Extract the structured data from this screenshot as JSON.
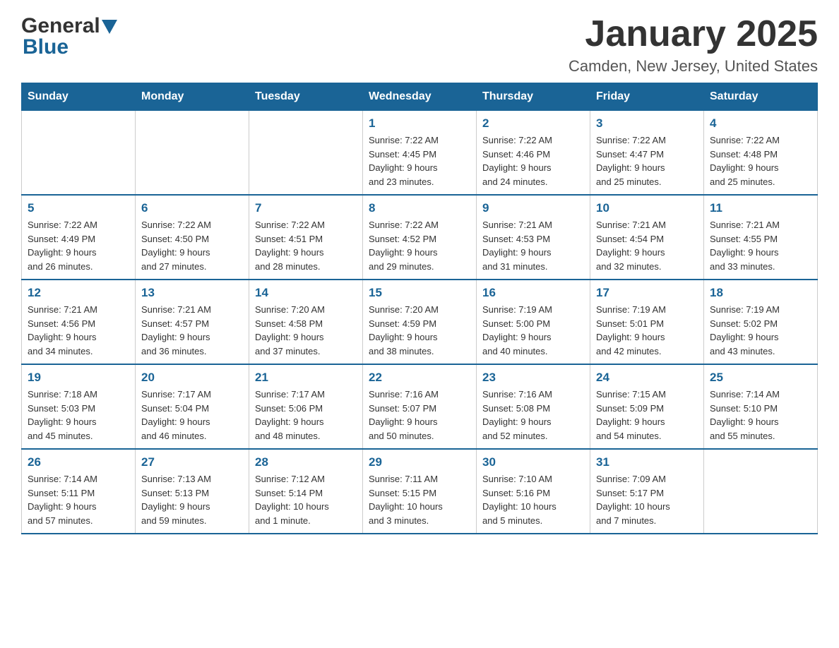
{
  "logo": {
    "general": "General",
    "blue": "Blue",
    "triangle_color": "#1a6496"
  },
  "header": {
    "title": "January 2025",
    "subtitle": "Camden, New Jersey, United States"
  },
  "weekdays": [
    "Sunday",
    "Monday",
    "Tuesday",
    "Wednesday",
    "Thursday",
    "Friday",
    "Saturday"
  ],
  "weeks": [
    [
      {
        "day": "",
        "info": ""
      },
      {
        "day": "",
        "info": ""
      },
      {
        "day": "",
        "info": ""
      },
      {
        "day": "1",
        "info": "Sunrise: 7:22 AM\nSunset: 4:45 PM\nDaylight: 9 hours\nand 23 minutes."
      },
      {
        "day": "2",
        "info": "Sunrise: 7:22 AM\nSunset: 4:46 PM\nDaylight: 9 hours\nand 24 minutes."
      },
      {
        "day": "3",
        "info": "Sunrise: 7:22 AM\nSunset: 4:47 PM\nDaylight: 9 hours\nand 25 minutes."
      },
      {
        "day": "4",
        "info": "Sunrise: 7:22 AM\nSunset: 4:48 PM\nDaylight: 9 hours\nand 25 minutes."
      }
    ],
    [
      {
        "day": "5",
        "info": "Sunrise: 7:22 AM\nSunset: 4:49 PM\nDaylight: 9 hours\nand 26 minutes."
      },
      {
        "day": "6",
        "info": "Sunrise: 7:22 AM\nSunset: 4:50 PM\nDaylight: 9 hours\nand 27 minutes."
      },
      {
        "day": "7",
        "info": "Sunrise: 7:22 AM\nSunset: 4:51 PM\nDaylight: 9 hours\nand 28 minutes."
      },
      {
        "day": "8",
        "info": "Sunrise: 7:22 AM\nSunset: 4:52 PM\nDaylight: 9 hours\nand 29 minutes."
      },
      {
        "day": "9",
        "info": "Sunrise: 7:21 AM\nSunset: 4:53 PM\nDaylight: 9 hours\nand 31 minutes."
      },
      {
        "day": "10",
        "info": "Sunrise: 7:21 AM\nSunset: 4:54 PM\nDaylight: 9 hours\nand 32 minutes."
      },
      {
        "day": "11",
        "info": "Sunrise: 7:21 AM\nSunset: 4:55 PM\nDaylight: 9 hours\nand 33 minutes."
      }
    ],
    [
      {
        "day": "12",
        "info": "Sunrise: 7:21 AM\nSunset: 4:56 PM\nDaylight: 9 hours\nand 34 minutes."
      },
      {
        "day": "13",
        "info": "Sunrise: 7:21 AM\nSunset: 4:57 PM\nDaylight: 9 hours\nand 36 minutes."
      },
      {
        "day": "14",
        "info": "Sunrise: 7:20 AM\nSunset: 4:58 PM\nDaylight: 9 hours\nand 37 minutes."
      },
      {
        "day": "15",
        "info": "Sunrise: 7:20 AM\nSunset: 4:59 PM\nDaylight: 9 hours\nand 38 minutes."
      },
      {
        "day": "16",
        "info": "Sunrise: 7:19 AM\nSunset: 5:00 PM\nDaylight: 9 hours\nand 40 minutes."
      },
      {
        "day": "17",
        "info": "Sunrise: 7:19 AM\nSunset: 5:01 PM\nDaylight: 9 hours\nand 42 minutes."
      },
      {
        "day": "18",
        "info": "Sunrise: 7:19 AM\nSunset: 5:02 PM\nDaylight: 9 hours\nand 43 minutes."
      }
    ],
    [
      {
        "day": "19",
        "info": "Sunrise: 7:18 AM\nSunset: 5:03 PM\nDaylight: 9 hours\nand 45 minutes."
      },
      {
        "day": "20",
        "info": "Sunrise: 7:17 AM\nSunset: 5:04 PM\nDaylight: 9 hours\nand 46 minutes."
      },
      {
        "day": "21",
        "info": "Sunrise: 7:17 AM\nSunset: 5:06 PM\nDaylight: 9 hours\nand 48 minutes."
      },
      {
        "day": "22",
        "info": "Sunrise: 7:16 AM\nSunset: 5:07 PM\nDaylight: 9 hours\nand 50 minutes."
      },
      {
        "day": "23",
        "info": "Sunrise: 7:16 AM\nSunset: 5:08 PM\nDaylight: 9 hours\nand 52 minutes."
      },
      {
        "day": "24",
        "info": "Sunrise: 7:15 AM\nSunset: 5:09 PM\nDaylight: 9 hours\nand 54 minutes."
      },
      {
        "day": "25",
        "info": "Sunrise: 7:14 AM\nSunset: 5:10 PM\nDaylight: 9 hours\nand 55 minutes."
      }
    ],
    [
      {
        "day": "26",
        "info": "Sunrise: 7:14 AM\nSunset: 5:11 PM\nDaylight: 9 hours\nand 57 minutes."
      },
      {
        "day": "27",
        "info": "Sunrise: 7:13 AM\nSunset: 5:13 PM\nDaylight: 9 hours\nand 59 minutes."
      },
      {
        "day": "28",
        "info": "Sunrise: 7:12 AM\nSunset: 5:14 PM\nDaylight: 10 hours\nand 1 minute."
      },
      {
        "day": "29",
        "info": "Sunrise: 7:11 AM\nSunset: 5:15 PM\nDaylight: 10 hours\nand 3 minutes."
      },
      {
        "day": "30",
        "info": "Sunrise: 7:10 AM\nSunset: 5:16 PM\nDaylight: 10 hours\nand 5 minutes."
      },
      {
        "day": "31",
        "info": "Sunrise: 7:09 AM\nSunset: 5:17 PM\nDaylight: 10 hours\nand 7 minutes."
      },
      {
        "day": "",
        "info": ""
      }
    ]
  ]
}
